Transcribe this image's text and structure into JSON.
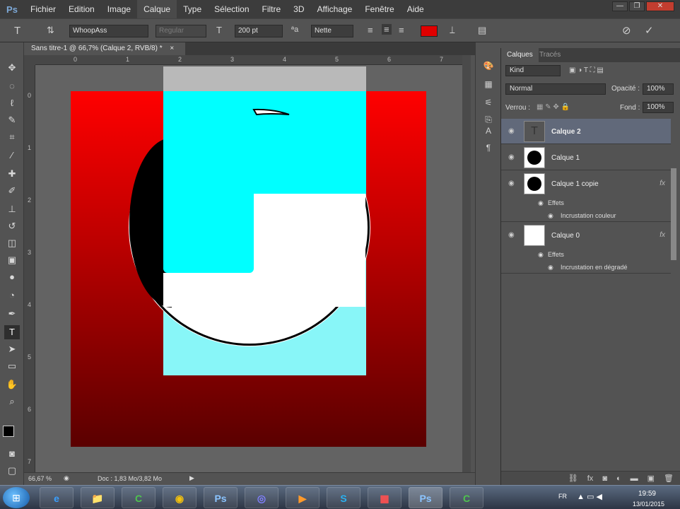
{
  "app": {
    "logo": "Ps"
  },
  "menu": [
    "Fichier",
    "Edition",
    "Image",
    "Calque",
    "Type",
    "Sélection",
    "Filtre",
    "3D",
    "Affichage",
    "Fenêtre",
    "Aide"
  ],
  "window_controls": {
    "minimize": "—",
    "restore": "❐",
    "close": "✕"
  },
  "options": {
    "font_family": "WhoopAss",
    "font_style": "Regular",
    "font_size": "200 pt",
    "antialias": "Nette",
    "text_color": "#e00000"
  },
  "document": {
    "tab_title": "Sans titre-1 @ 66,7% (Calque 2, RVB/8) *",
    "tab_close": "×",
    "ruler_h": [
      "0",
      "1",
      "2",
      "3",
      "4",
      "5",
      "6",
      "7"
    ],
    "ruler_v": [
      "0",
      "1",
      "2",
      "3",
      "4",
      "5",
      "6",
      "7"
    ]
  },
  "status": {
    "zoom": "66,67 %",
    "doc_info": "Doc : 1,83 Mo/3,82 Mo"
  },
  "layers_panel": {
    "tabs": [
      "Calques",
      "Tracés"
    ],
    "filter": "Kind",
    "blend_mode": "Normal",
    "opacity_label": "Opacité :",
    "opacity_value": "100%",
    "lock_label": "Verrou :",
    "fill_label": "Fond :",
    "fill_value": "100%",
    "layers": [
      {
        "name": "Calque 2",
        "type": "text",
        "selected": true
      },
      {
        "name": "Calque 1",
        "type": "circle"
      },
      {
        "name": "Calque 1 copie",
        "type": "circle",
        "fx": "fx",
        "effects_label": "Effets",
        "effects": [
          "Incrustation couleur"
        ]
      },
      {
        "name": "Calque 0",
        "type": "white",
        "fx": "fx",
        "effects_label": "Effets",
        "effects": [
          "Incrustation en dégradé"
        ]
      }
    ]
  },
  "taskbar": {
    "apps": [
      "e",
      "📁",
      "C",
      "◉",
      "Ps",
      "◎",
      "▶",
      "S",
      "▦",
      "Ps",
      "C"
    ],
    "lang": "FR",
    "time": "19:59",
    "date": "13/01/2015"
  },
  "colors": {
    "accent_text_color": "#e00000",
    "cyan": "#00ffff",
    "selected_layer": "#61697a"
  }
}
